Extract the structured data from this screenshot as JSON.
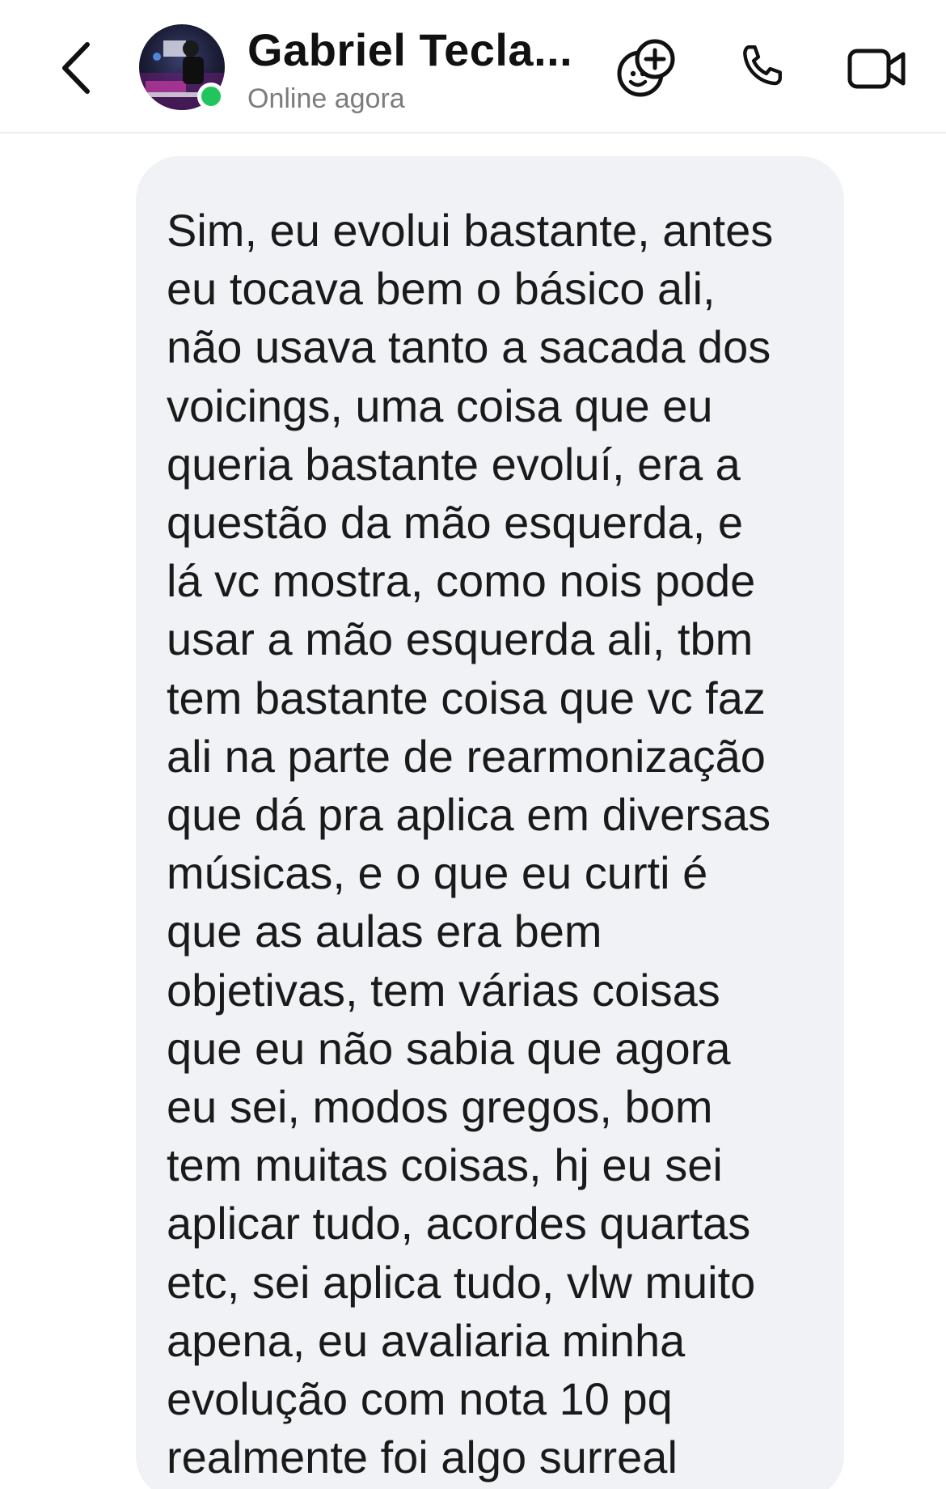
{
  "header": {
    "contact_name": "Gabriel Tecla...",
    "status": "Online agora",
    "presence_color": "#21c55d",
    "icons": {
      "back": "chevron-left-icon",
      "effects": "add-friend-face-icon",
      "call": "phone-icon",
      "video": "video-camera-icon"
    }
  },
  "message": {
    "sender": "incoming",
    "text": "Sim, eu evolui bastante, antes\neu tocava bem o básico ali,\nnão usava tanto a sacada dos\nvoicings, uma coisa que eu\nqueria bastante evoluí, era a\nquestão da mão esquerda, e\nlá vc mostra, como nois pode\nusar a mão esquerda ali, tbm\ntem bastante coisa que vc faz\nali na parte de rearmonização\nque dá pra aplica em diversas\nmúsicas, e o que eu curti é\nque as aulas era bem\nobjetivas, tem várias coisas\nque eu não sabia que agora\neu sei, modos gregos, bom\ntem muitas coisas, hj eu sei\naplicar tudo, acordes quartas\netc, sei aplica tudo, vlw muito\napena, eu avaliaria minha\nevolução com nota 10 pq\nrealmente foi algo surreal",
    "bubble_color": "#f1f2f5"
  }
}
